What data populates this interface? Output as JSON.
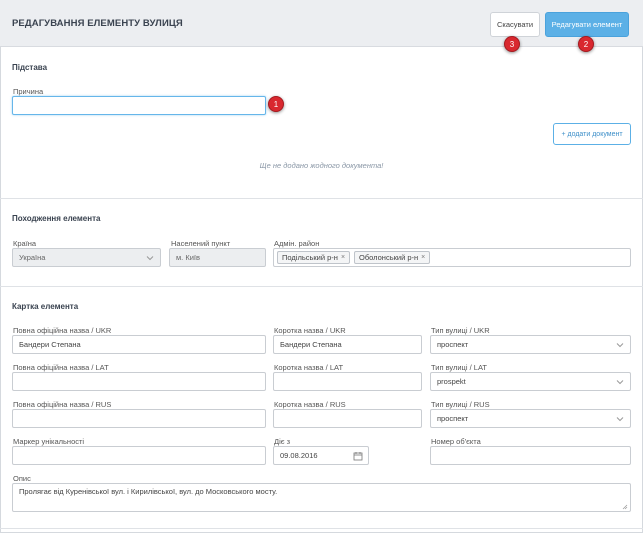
{
  "header": {
    "title": "РЕДАГУВАННЯ ЕЛЕМЕНТУ ВУЛИЦЯ",
    "cancel_label": "Скасувати",
    "edit_label": "Редагувати елемент"
  },
  "badges": {
    "b1": "1",
    "b2": "2",
    "b3": "3"
  },
  "basis": {
    "title": "Підстава",
    "reason_label": "Причина",
    "reason_value": "",
    "add_doc_label": "+ додати документ",
    "empty_note": "Ще не додано жодного документа!"
  },
  "origin": {
    "title": "Походження елемента",
    "country_label": "Країна",
    "country_value": "Україна",
    "city_label": "Населений пункт",
    "city_value": "м. Київ",
    "district_label": "Адмін. район",
    "districts": [
      "Подільський р-н",
      "Оболонський р-н"
    ]
  },
  "card": {
    "title": "Картка елемента",
    "full_ukr_label": "Повна офіційна назва / UKR",
    "full_ukr_value": "Бандери Степана",
    "short_ukr_label": "Коротка назва / UKR",
    "short_ukr_value": "Бандери Степана",
    "type_ukr_label": "Тип вулиці / UKR",
    "type_ukr_value": "проспект",
    "full_lat_label": "Повна офіційна назва / LAT",
    "full_lat_value": "",
    "short_lat_label": "Коротка назва / LAT",
    "short_lat_value": "",
    "type_lat_label": "Тип вулиці / LAT",
    "type_lat_value": "prospekt",
    "full_rus_label": "Повна офіційна назва / RUS",
    "full_rus_value": "",
    "short_rus_label": "Коротка назва / RUS",
    "short_rus_value": "",
    "type_rus_label": "Тип вулиці / RUS",
    "type_rus_value": "проспект",
    "marker_label": "Маркер унікальності",
    "marker_value": "",
    "valid_from_label": "Діє з",
    "valid_from_value": "09.08.2016",
    "object_no_label": "Номер об'єкта",
    "object_no_value": "",
    "desc_label": "Опис",
    "desc_value": "Пролягає від Куренівської вул. і Кирилівської, вул. до Московського мосту."
  }
}
